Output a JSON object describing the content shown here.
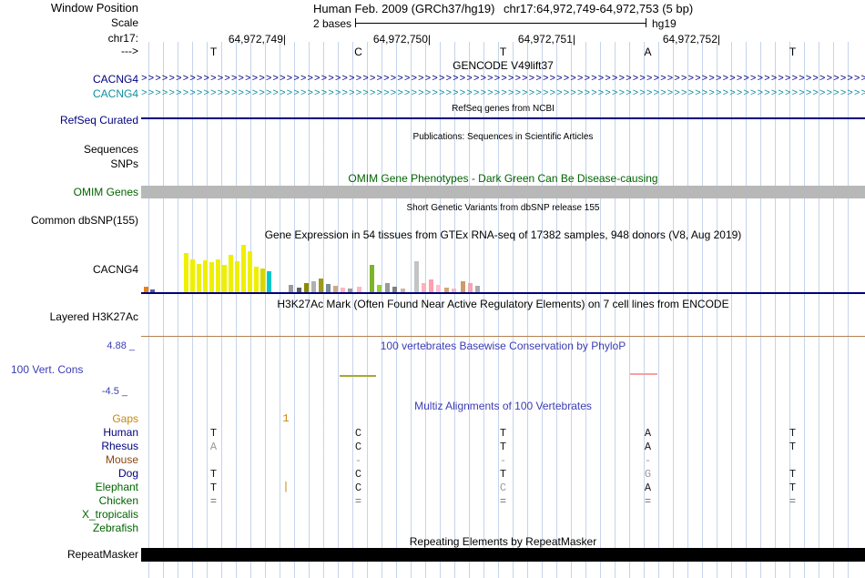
{
  "header": {
    "window_position_label": "Window Position",
    "assembly": "Human Feb. 2009 (GRCh37/hg19)",
    "position": "chr17:64,972,749-64,972,753 (5 bp)",
    "scale_label": "Scale",
    "scale_text": "2 bases",
    "genome": "hg19",
    "chrom_label": "chr17:",
    "coordinates": [
      "64,972,749|",
      "64,972,750|",
      "64,972,751|",
      "64,972,752|"
    ],
    "strand_label": "--->",
    "bases": [
      "T",
      "C",
      "T",
      "A",
      "T"
    ]
  },
  "tracks": {
    "gencode": {
      "title": "GENCODE V49lift37",
      "row1_label": "CACNG4",
      "row2_label": "CACNG4",
      "arrows": ">>>>>>>>>>>>>>>>>>>>>>>>>>>>>>>>>>>>>>>>>>>>>>>>>>>>>>>>>>>>>>>>>>>>>>>>>>>>>>>>>>>>>>>>>>>>>>>>>>>>>>>>>>>>>>>>>>>>"
    },
    "refseq": {
      "subtitle": "RefSeq genes from NCBI",
      "label": "RefSeq Curated"
    },
    "publications": {
      "subtitle": "Publications: Sequences in Scientific Articles"
    },
    "sequences_label": "Sequences",
    "snps_label": "SNPs",
    "omim": {
      "title": "OMIM Gene Phenotypes - Dark Green Can Be Disease-causing",
      "label": "OMIM Genes"
    },
    "dbsnp": {
      "subtitle": "Short Genetic Variants from dbSNP release 155",
      "label": "Common dbSNP(155)"
    },
    "gtex": {
      "title": "Gene Expression in 54 tissues from GTEx RNA-seq of 17382 samples, 948 donors (V8, Aug 2019)",
      "label": "CACNG4"
    },
    "h3k27ac": {
      "title": "H3K27Ac Mark (Often Found Near Active Regulatory Elements) on 7 cell lines from ENCODE",
      "label": "Layered H3K27Ac"
    },
    "conservation": {
      "title": "100 vertebrates Basewise Conservation by PhyloP",
      "label": "100 Vert. Cons",
      "max": "4.88 _",
      "min": "-4.5 _"
    },
    "repeatmasker": {
      "title": "Repeating Elements by RepeatMasker",
      "label": "RepeatMasker"
    }
  },
  "multiz": {
    "title": "Multiz Alignments of 100 Vertebrates",
    "gaps": {
      "label": "Gaps",
      "insert_count": "1"
    },
    "rows": [
      {
        "name": "Human",
        "label_color": "#000080",
        "cells": [
          {
            "c": "T"
          },
          {
            "c": "C"
          },
          {
            "c": "T"
          },
          {
            "c": "A"
          },
          {
            "c": "T"
          }
        ]
      },
      {
        "name": "Rhesus",
        "label_color": "#000080",
        "cells": [
          {
            "c": "A",
            "color": "#9a9a9a"
          },
          {
            "c": "C"
          },
          {
            "c": "T"
          },
          {
            "c": "A"
          },
          {
            "c": "T"
          }
        ]
      },
      {
        "name": "Mouse",
        "label_color": "#8b4513",
        "cells": [
          {
            "c": ""
          },
          {
            "c": "-",
            "color": "#9a9a9a"
          },
          {
            "c": "-",
            "color": "#9a9a9a"
          },
          {
            "c": "-",
            "color": "#9a9a9a"
          },
          {
            "c": ""
          }
        ]
      },
      {
        "name": "Dog",
        "label_color": "#000080",
        "cells": [
          {
            "c": "T"
          },
          {
            "c": "C"
          },
          {
            "c": "T"
          },
          {
            "c": "G",
            "color": "#9a9a9a"
          },
          {
            "c": "T"
          }
        ]
      },
      {
        "name": "Elephant",
        "label_color": "#006400",
        "insert_marker": "|",
        "cells": [
          {
            "c": "T"
          },
          {
            "c": "C"
          },
          {
            "c": "C",
            "color": "#9a9a9a"
          },
          {
            "c": "A"
          },
          {
            "c": "T"
          }
        ]
      },
      {
        "name": "Chicken",
        "label_color": "#006400",
        "cells": [
          {
            "c": "=",
            "color": "#707070"
          },
          {
            "c": "=",
            "color": "#707070"
          },
          {
            "c": "=",
            "color": "#707070"
          },
          {
            "c": "=",
            "color": "#707070"
          },
          {
            "c": "=",
            "color": "#707070"
          }
        ]
      },
      {
        "name": "X_tropicalis",
        "label_color": "#006400",
        "cells": [
          {
            "c": ""
          },
          {
            "c": ""
          },
          {
            "c": ""
          },
          {
            "c": ""
          },
          {
            "c": ""
          }
        ]
      },
      {
        "name": "Zebrafish",
        "label_color": "#006400",
        "cells": [
          {
            "c": ""
          },
          {
            "c": ""
          },
          {
            "c": ""
          },
          {
            "c": ""
          },
          {
            "c": ""
          }
        ]
      }
    ]
  },
  "chart_data": [
    {
      "type": "bar",
      "name": "gtex_gene_expression",
      "gene": "CACNG4",
      "title": "Gene Expression in 54 tissues from GTEx RNA-seq of 17382 samples, 948 donors (V8, Aug 2019)",
      "unit": "relative expression (bar height px, est. from image)",
      "bars": [
        {
          "x": 3,
          "h": 6,
          "color": "#e8820e"
        },
        {
          "x": 10,
          "h": 3,
          "color": "#5c5c9e"
        },
        {
          "x": 47,
          "h": 43,
          "color": "#efef00"
        },
        {
          "x": 54,
          "h": 36,
          "color": "#efef00"
        },
        {
          "x": 61,
          "h": 31,
          "color": "#efef00"
        },
        {
          "x": 68,
          "h": 35,
          "color": "#efef00"
        },
        {
          "x": 75,
          "h": 33,
          "color": "#efef00"
        },
        {
          "x": 82,
          "h": 36,
          "color": "#efef00"
        },
        {
          "x": 89,
          "h": 30,
          "color": "#efef00"
        },
        {
          "x": 96,
          "h": 41,
          "color": "#efef00"
        },
        {
          "x": 103,
          "h": 34,
          "color": "#efef00"
        },
        {
          "x": 110,
          "h": 52,
          "color": "#efef00"
        },
        {
          "x": 117,
          "h": 45,
          "color": "#efef00"
        },
        {
          "x": 124,
          "h": 28,
          "color": "#efef00"
        },
        {
          "x": 131,
          "h": 26,
          "color": "#d7d700"
        },
        {
          "x": 138,
          "h": 23,
          "color": "#00c8c8"
        },
        {
          "x": 162,
          "h": 8,
          "color": "#9a9a9a"
        },
        {
          "x": 171,
          "h": 5,
          "color": "#5e5e5e"
        },
        {
          "x": 179,
          "h": 10,
          "color": "#8b8b00"
        },
        {
          "x": 187,
          "h": 12,
          "color": "#b0b0b0"
        },
        {
          "x": 195,
          "h": 15,
          "color": "#99991e"
        },
        {
          "x": 203,
          "h": 9,
          "color": "#7a8a99"
        },
        {
          "x": 211,
          "h": 7,
          "color": "#cdaa7d"
        },
        {
          "x": 219,
          "h": 5,
          "color": "#ffb6c1"
        },
        {
          "x": 227,
          "h": 4,
          "color": "#9a9a9a"
        },
        {
          "x": 237,
          "h": 6,
          "color": "#ffb6c1"
        },
        {
          "x": 251,
          "h": 30,
          "color": "#7db32b"
        },
        {
          "x": 259,
          "h": 8,
          "color": "#9acd32"
        },
        {
          "x": 268,
          "h": 10,
          "color": "#9a9a9a"
        },
        {
          "x": 276,
          "h": 6,
          "color": "#808080"
        },
        {
          "x": 285,
          "h": 4,
          "color": "#cdb79e"
        },
        {
          "x": 300,
          "h": 34,
          "color": "#c3c3c3"
        },
        {
          "x": 308,
          "h": 10,
          "color": "#ffb0bb"
        },
        {
          "x": 316,
          "h": 14,
          "color": "#ff9fae"
        },
        {
          "x": 324,
          "h": 8,
          "color": "#ffc0cb"
        },
        {
          "x": 333,
          "h": 5,
          "color": "#d2a56e"
        },
        {
          "x": 341,
          "h": 4,
          "color": "#f4b8c4"
        },
        {
          "x": 351,
          "h": 12,
          "color": "#cd9b67"
        },
        {
          "x": 359,
          "h": 10,
          "color": "#f0a6b4"
        },
        {
          "x": 367,
          "h": 7,
          "color": "#ababab"
        }
      ]
    },
    {
      "type": "line",
      "name": "phylop_conservation",
      "title": "100 vertebrates Basewise Conservation by PhyloP",
      "ylim": [
        -4.5,
        4.88
      ],
      "marks": [
        {
          "x": 218,
          "w": 40,
          "y": 412,
          "color": "#a8a832"
        },
        {
          "x": 537,
          "w": 30,
          "y": 410,
          "color": "#f2a2a2"
        }
      ]
    }
  ]
}
